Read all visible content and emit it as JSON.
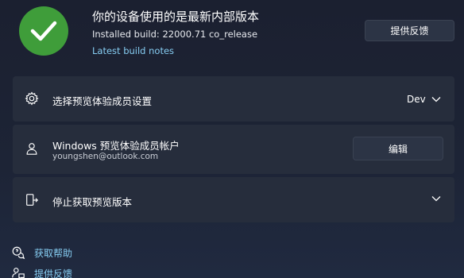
{
  "status": {
    "title": "你的设备使用的是最新内部版本",
    "build": "Installed build: 22000.71 co_release",
    "notes_link": "Latest build notes",
    "feedback_button": "提供反馈"
  },
  "settings": {
    "channel": {
      "label": "选择预览体验成员设置",
      "value": "Dev"
    },
    "account": {
      "label": "Windows 预览体验成员帐户",
      "email": "youngshen@outlook.com",
      "edit_button": "编辑"
    },
    "stop": {
      "label": "停止获取预览版本"
    }
  },
  "footer": {
    "help": "获取帮助",
    "feedback": "提供反馈"
  },
  "colors": {
    "accent_link": "#86cdf2",
    "success": "#3f9d3a",
    "card": "#262d3c"
  }
}
